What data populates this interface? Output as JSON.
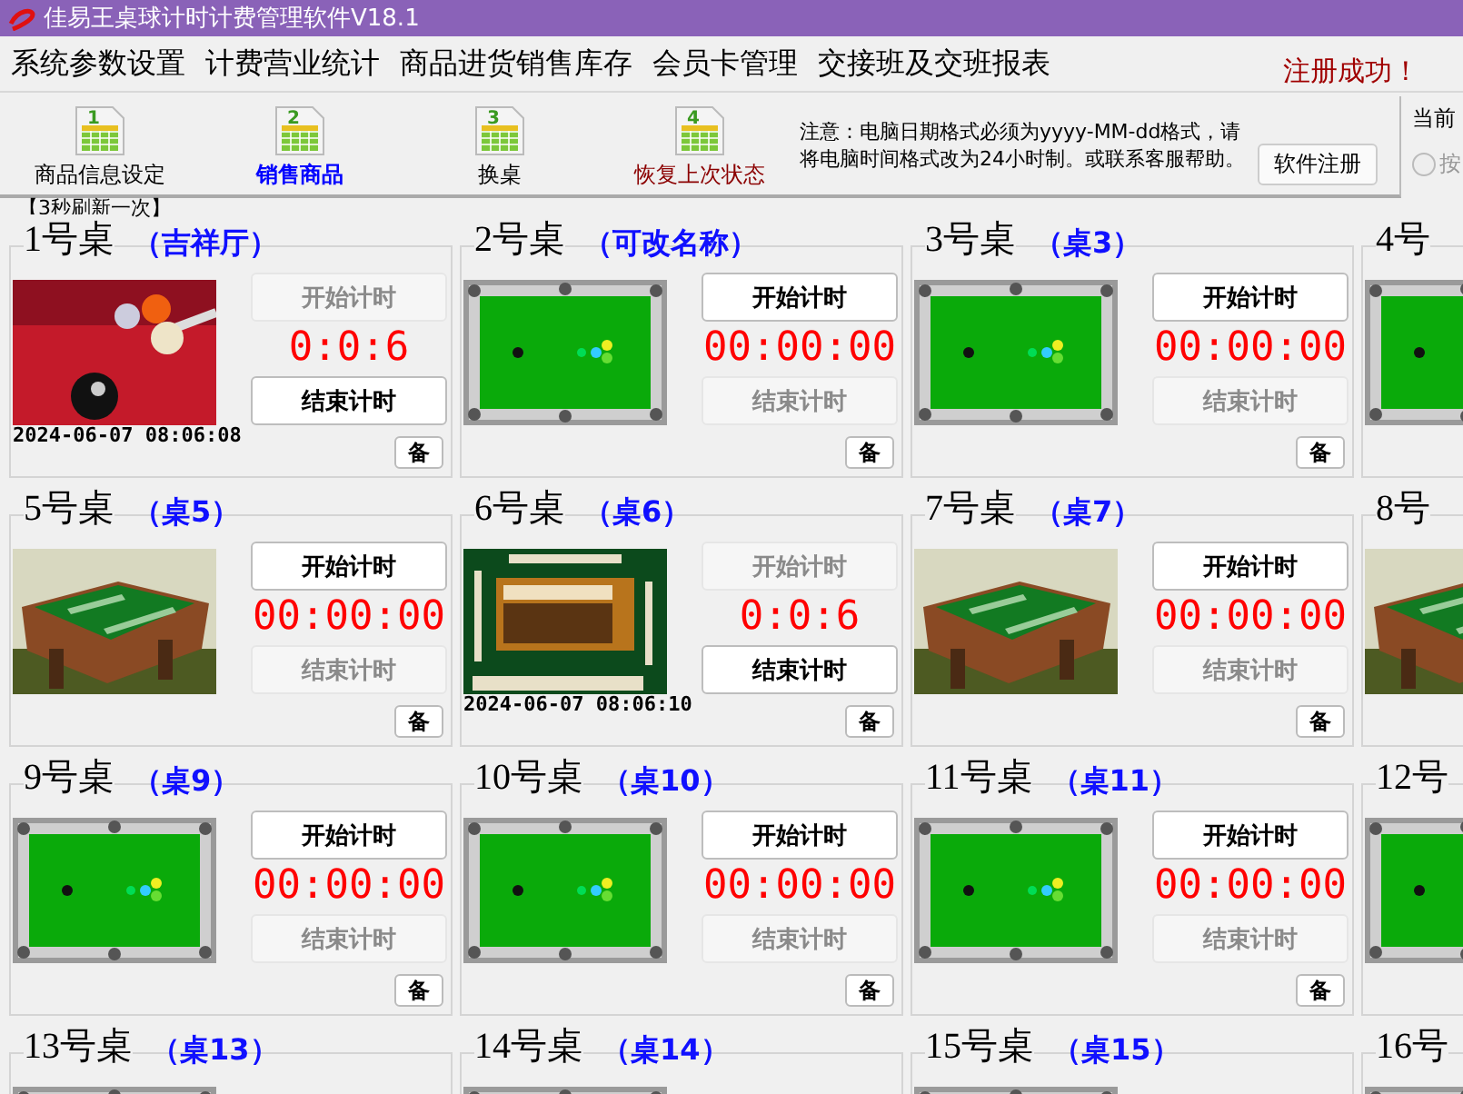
{
  "window": {
    "title": "佳易王桌球计时计费管理软件V18.1"
  },
  "menu": [
    "系统参数设置",
    "计费营业统计",
    "商品进货销售库存",
    "会员卡管理",
    "交接班及交班报表"
  ],
  "status_message": "注册成功！",
  "toolbar": [
    {
      "badge": "1",
      "label": "商品信息设定",
      "selected": false,
      "color": "#000000"
    },
    {
      "badge": "2",
      "label": "销售商品",
      "selected": true,
      "color": "#0000ff"
    },
    {
      "badge": "3",
      "label": "换桌",
      "selected": false,
      "color": "#000000"
    },
    {
      "badge": "4",
      "label": "恢复上次状态",
      "selected": false,
      "color": "#8b0000"
    }
  ],
  "notice": "注意：电脑日期格式必须为yyyy-MM-dd格式，请将电脑时间格式改为24小时制。或联系客服帮助。",
  "register_button": "软件注册",
  "side_panel": {
    "title": "当前",
    "option": {
      "label": "按",
      "selected": false,
      "disabled": true
    }
  },
  "refresh_note": "【3秒刷新一次】",
  "tables": [
    {
      "title": "1号桌",
      "name": "（吉祥厅）",
      "start": {
        "label": "开始计时",
        "disabled": true
      },
      "timer": "0:0:6",
      "end": {
        "label": "结束计时",
        "disabled": false
      },
      "timestamp": "2024-06-07 08:06:08",
      "note": "备"
    },
    {
      "title": "2号桌",
      "name": "（可改名称）",
      "kind": "pool",
      "start": {
        "label": "开始计时",
        "disabled": false
      },
      "timer": "00:00:00",
      "end": {
        "label": "结束计时",
        "disabled": true
      },
      "note": "备"
    },
    {
      "title": "3号桌",
      "name": "（桌3）",
      "kind": "pool",
      "start": {
        "label": "开始计时",
        "disabled": false
      },
      "timer": "00:00:00",
      "end": {
        "label": "结束计时",
        "disabled": true
      },
      "note": "备"
    },
    {
      "title": "4号",
      "kind": "pool"
    },
    {
      "title": "5号桌",
      "name": "（桌5）",
      "kind": "mahjong",
      "start": {
        "label": "开始计时",
        "disabled": false
      },
      "timer": "00:00:00",
      "end": {
        "label": "结束计时",
        "disabled": true
      },
      "note": "备"
    },
    {
      "title": "6号桌",
      "name": "（桌6）",
      "kind": "game",
      "start": {
        "label": "开始计时",
        "disabled": true
      },
      "timer": "0:0:6",
      "end": {
        "label": "结束计时",
        "disabled": false
      },
      "timestamp": "2024-06-07 08:06:10",
      "note": "备"
    },
    {
      "title": "7号桌",
      "name": "（桌7）",
      "kind": "mahjong",
      "start": {
        "label": "开始计时",
        "disabled": false
      },
      "timer": "00:00:00",
      "end": {
        "label": "结束计时",
        "disabled": true
      },
      "note": "备"
    },
    {
      "title": "8号",
      "kind": "mahjong"
    },
    {
      "title": "9号桌",
      "name": "（桌9）",
      "kind": "pool",
      "start": {
        "label": "开始计时",
        "disabled": false
      },
      "timer": "00:00:00",
      "end": {
        "label": "结束计时",
        "disabled": true
      },
      "note": "备"
    },
    {
      "title": "10号桌",
      "name": "（桌10）",
      "kind": "pool",
      "start": {
        "label": "开始计时",
        "disabled": false
      },
      "timer": "00:00:00",
      "end": {
        "label": "结束计时",
        "disabled": true
      },
      "note": "备"
    },
    {
      "title": "11号桌",
      "name": "（桌11）",
      "kind": "pool",
      "start": {
        "label": "开始计时",
        "disabled": false
      },
      "timer": "00:00:00",
      "end": {
        "label": "结束计时",
        "disabled": true
      },
      "note": "备"
    },
    {
      "title": "12号",
      "kind": "pool"
    },
    {
      "title": "13号桌",
      "name": "（桌13）",
      "kind": "pool"
    },
    {
      "title": "14号桌",
      "name": "（桌14）",
      "kind": "pool"
    },
    {
      "title": "15号桌",
      "name": "（桌15）",
      "kind": "pool"
    },
    {
      "title": "16号",
      "kind": "pool"
    }
  ]
}
